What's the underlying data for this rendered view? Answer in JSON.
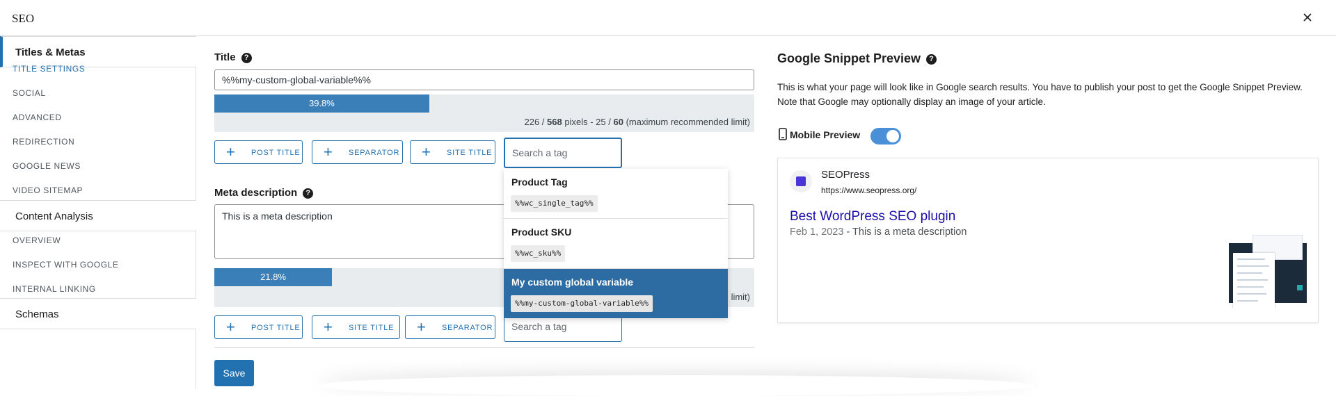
{
  "header": {
    "title": "SEO"
  },
  "sidebar": {
    "group_titles": "Titles & Metas",
    "titles_items": [
      "TITLE SETTINGS",
      "SOCIAL",
      "ADVANCED",
      "REDIRECTION",
      "GOOGLE NEWS",
      "VIDEO SITEMAP"
    ],
    "group_analysis": "Content Analysis",
    "analysis_items": [
      "OVERVIEW",
      "INSPECT WITH GOOGLE",
      "INTERNAL LINKING"
    ],
    "group_schemas": "Schemas"
  },
  "title_field": {
    "label": "Title",
    "value": "%%my-custom-global-variable%%",
    "progress_percent": 39.8,
    "progress_label": "39.8%",
    "pixels_used": "226",
    "pixels_max": "568",
    "chars_used": "25",
    "chars_max": "60",
    "counter_units": "pixels",
    "counter_suffix": "(maximum recommended limit)",
    "buttons": [
      "POST TITLE",
      "SEPARATOR",
      "SITE TITLE"
    ],
    "search_placeholder": "Search a tag"
  },
  "meta_field": {
    "label": "Meta description",
    "value": "This is a meta description",
    "progress_percent": 21.8,
    "progress_label": "21.8%",
    "counter_tail": "limit)",
    "buttons": [
      "POST TITLE",
      "SITE TITLE",
      "SEPARATOR"
    ],
    "search_placeholder": "Search a tag"
  },
  "dropdown": [
    {
      "name": "Product Tag",
      "code": "%%wc_single_tag%%",
      "selected": false
    },
    {
      "name": "Product SKU",
      "code": "%%wc_sku%%",
      "selected": false
    },
    {
      "name": "My custom global variable",
      "code": "%%my-custom-global-variable%%",
      "selected": true
    }
  ],
  "save_label": "Save",
  "preview": {
    "title": "Google Snippet Preview",
    "description": "This is what your page will look like in Google search results. You have to publish your post to get the Google Snippet Preview. Note that Google may optionally display an image of your article.",
    "mobile_label": "Mobile Preview",
    "mobile_enabled": true,
    "site_name": "SEOPress",
    "site_url": "https://www.seopress.org/",
    "result_title": "Best WordPress SEO plugin",
    "result_date": "Feb 1, 2023",
    "result_desc": "This is a meta description"
  },
  "colors": {
    "accent": "#2271b1",
    "bar": "#3a7fb8",
    "selected": "#2c6ca3",
    "link": "#1a0dab"
  },
  "icons": {
    "close": "close-icon",
    "help": "help-icon",
    "plus": "plus-icon",
    "mobile": "mobile-phone-icon"
  }
}
